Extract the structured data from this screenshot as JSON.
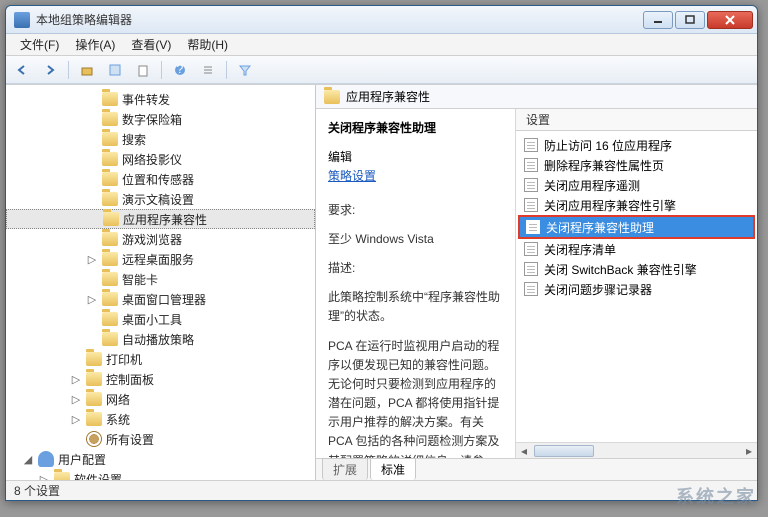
{
  "window": {
    "title": "本地组策略编辑器"
  },
  "menu": {
    "file": "文件(F)",
    "action": "操作(A)",
    "view": "查看(V)",
    "help": "帮助(H)"
  },
  "tree": [
    {
      "indent": 5,
      "expander": "",
      "icon": "fld",
      "label": "事件转发"
    },
    {
      "indent": 5,
      "expander": "",
      "icon": "fld",
      "label": "数字保险箱"
    },
    {
      "indent": 5,
      "expander": "",
      "icon": "fld",
      "label": "搜索"
    },
    {
      "indent": 5,
      "expander": "",
      "icon": "fld",
      "label": "网络投影仪"
    },
    {
      "indent": 5,
      "expander": "",
      "icon": "fld",
      "label": "位置和传感器"
    },
    {
      "indent": 5,
      "expander": "",
      "icon": "fld",
      "label": "演示文稿设置"
    },
    {
      "indent": 5,
      "expander": "",
      "icon": "fld",
      "label": "应用程序兼容性",
      "selected": true
    },
    {
      "indent": 5,
      "expander": "",
      "icon": "fld",
      "label": "游戏浏览器"
    },
    {
      "indent": 5,
      "expander": "▷",
      "icon": "fld",
      "label": "远程桌面服务"
    },
    {
      "indent": 5,
      "expander": "",
      "icon": "fld",
      "label": "智能卡"
    },
    {
      "indent": 5,
      "expander": "▷",
      "icon": "fld",
      "label": "桌面窗口管理器"
    },
    {
      "indent": 5,
      "expander": "",
      "icon": "fld",
      "label": "桌面小工具"
    },
    {
      "indent": 5,
      "expander": "",
      "icon": "fld",
      "label": "自动播放策略"
    },
    {
      "indent": 4,
      "expander": "",
      "icon": "fld",
      "label": "打印机"
    },
    {
      "indent": 4,
      "expander": "▷",
      "icon": "fld",
      "label": "控制面板"
    },
    {
      "indent": 4,
      "expander": "▷",
      "icon": "fld",
      "label": "网络"
    },
    {
      "indent": 4,
      "expander": "▷",
      "icon": "fld",
      "label": "系统"
    },
    {
      "indent": 4,
      "expander": "",
      "icon": "gear",
      "label": "所有设置"
    },
    {
      "indent": 1,
      "expander": "◢",
      "icon": "usr",
      "label": "用户配置"
    },
    {
      "indent": 2,
      "expander": "▷",
      "icon": "fld",
      "label": "软件设置"
    }
  ],
  "main": {
    "header": "应用程序兼容性",
    "desc": {
      "title": "关闭程序兼容性助理",
      "edit_label": "编辑",
      "edit_link": "策略设置",
      "req_label": "要求:",
      "req_value": "至少 Windows Vista",
      "desc_label": "描述:",
      "desc_p1": "此策略控制系统中“程序兼容性助理”的状态。",
      "desc_p2": "PCA 在运行时监视用户启动的程序以便发现已知的兼容性问题。无论何时只要检测到应用程序的潜在问题，PCA 都将使用指针提示用户推荐的解决方案。有关 PCA 包括的各种问题检测方案及其配置策略的详细信息，请参阅“系统->疑难解答和诊断->应用程序兼容性诊断”下的策略。"
    },
    "list": {
      "col_header": "设置",
      "items": [
        {
          "label": "防止访问 16 位应用程序"
        },
        {
          "label": "删除程序兼容性属性页"
        },
        {
          "label": "关闭应用程序遥测"
        },
        {
          "label": "关闭应用程序兼容性引擎"
        },
        {
          "label": "关闭程序兼容性助理",
          "selected": true,
          "highlight": true
        },
        {
          "label": "关闭程序清单"
        },
        {
          "label": "关闭 SwitchBack 兼容性引擎"
        },
        {
          "label": "关闭问题步骤记录器"
        }
      ]
    },
    "tabs": {
      "active": "标准",
      "inactive": "扩展"
    }
  },
  "status": {
    "text": "8 个设置"
  },
  "watermark": "系统之家"
}
